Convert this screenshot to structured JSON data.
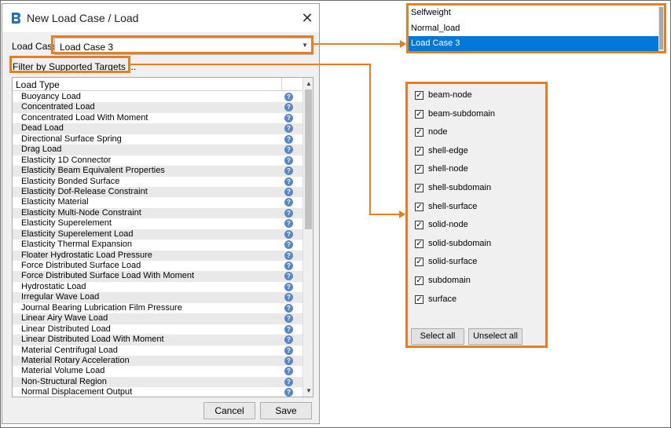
{
  "dialog": {
    "title": "New Load Case / Load",
    "load_case_label": "Load Case",
    "load_case_value": "Load Case 3",
    "filter_label": "Filter by Supported Targets ...",
    "list_header": "Load Type",
    "load_types": [
      "Buoyancy Load",
      "Concentrated Load",
      "Concentrated Load With Moment",
      "Dead Load",
      "Directional Surface Spring",
      "Drag Load",
      "Elasticity 1D Connector",
      "Elasticity Beam Equivalent Properties",
      "Elasticity Bonded Surface",
      "Elasticity Dof-Release Constraint",
      "Elasticity Material",
      "Elasticity Multi-Node Constraint",
      "Elasticity Superelement",
      "Elasticity Superelement Load",
      "Elasticity Thermal Expansion",
      "Floater Hydrostatic Load Pressure",
      "Force Distributed Surface Load",
      "Force Distributed Surface Load With Moment",
      "Hydrostatic Load",
      "Irregular Wave Load",
      "Journal Bearing Lubrication Film Pressure",
      "Linear Airy Wave Load",
      "Linear Distributed Load",
      "Linear Distributed Load With Moment",
      "Material Centrifugal Load",
      "Material Rotary Acceleration",
      "Material Volume Load",
      "Non-Structural Region",
      "Normal Displacement Output"
    ],
    "cancel_label": "Cancel",
    "save_label": "Save"
  },
  "dropdown": {
    "options": [
      "Selfweight",
      "Normal_load",
      "Load Case 3"
    ],
    "selected_index": 2
  },
  "targets": {
    "items": [
      {
        "label": "beam-node",
        "checked": true
      },
      {
        "label": "beam-subdomain",
        "checked": true
      },
      {
        "label": "node",
        "checked": true
      },
      {
        "label": "shell-edge",
        "checked": true
      },
      {
        "label": "shell-node",
        "checked": true
      },
      {
        "label": "shell-subdomain",
        "checked": true
      },
      {
        "label": "shell-surface",
        "checked": true
      },
      {
        "label": "solid-node",
        "checked": true
      },
      {
        "label": "solid-subdomain",
        "checked": true
      },
      {
        "label": "solid-surface",
        "checked": true
      },
      {
        "label": "subdomain",
        "checked": true
      },
      {
        "label": "surface",
        "checked": true
      }
    ],
    "select_all_label": "Select all",
    "unselect_all_label": "Unselect all"
  },
  "colors": {
    "highlight": "#e67e22",
    "selection": "#0078d7",
    "info_icon": "#5b86c5"
  },
  "icons": {
    "app": "app-logo-icon",
    "close": "close-icon",
    "dropdown": "chevron-down-icon",
    "info": "info-icon",
    "check": "checkmark-icon"
  }
}
